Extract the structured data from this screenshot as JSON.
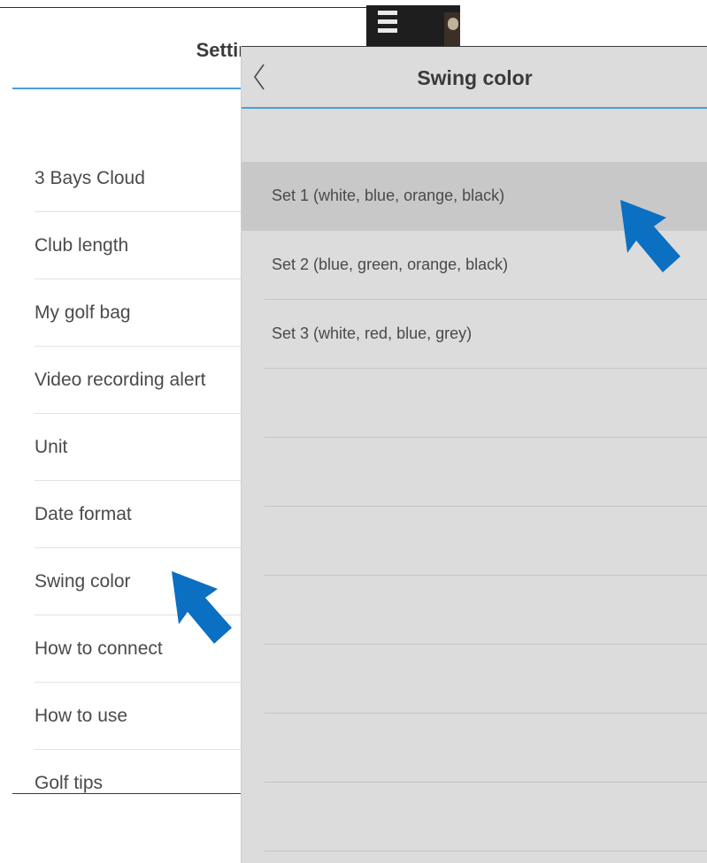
{
  "settings": {
    "title": "Settings",
    "items": [
      {
        "label": "3 Bays Cloud"
      },
      {
        "label": "Club length"
      },
      {
        "label": "My golf bag"
      },
      {
        "label": "Video recording alert"
      },
      {
        "label": "Unit"
      },
      {
        "label": "Date format"
      },
      {
        "label": "Swing color"
      },
      {
        "label": "How to connect"
      },
      {
        "label": "How to use"
      },
      {
        "label": "Golf tips"
      }
    ]
  },
  "panel": {
    "title": "Swing color",
    "back_icon": "chevron-left-icon",
    "options": [
      {
        "label": "Set 1 (white, blue, orange, black)",
        "selected": true
      },
      {
        "label": "Set 2 (blue, green, orange, black)",
        "selected": false
      },
      {
        "label": "Set 3 (white, red, blue, grey)",
        "selected": false
      }
    ]
  },
  "colors": {
    "accent": "#4a9ede",
    "annotation_arrow": "#0b6fc2",
    "panel_bg": "#dcdcdc",
    "selected_row": "#c8c8c8"
  }
}
